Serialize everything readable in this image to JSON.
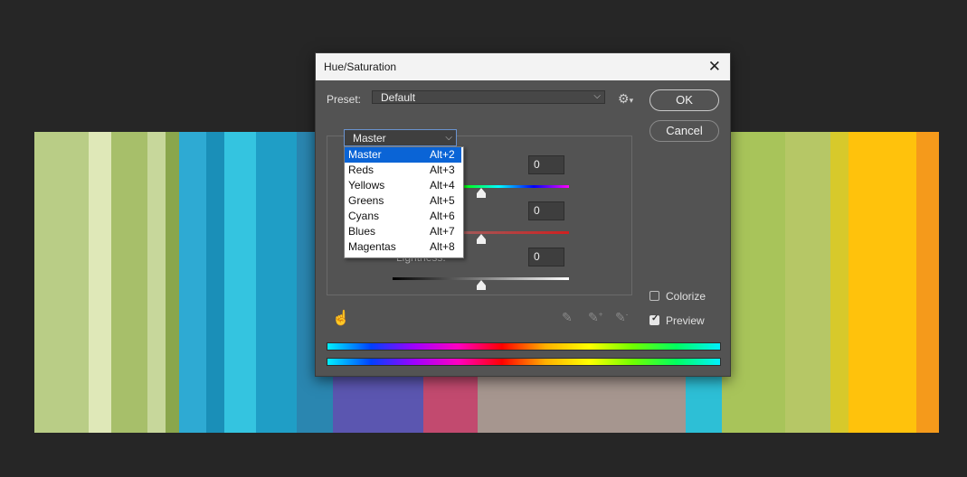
{
  "dialog": {
    "title": "Hue/Saturation",
    "close_glyph": "✕",
    "preset_label": "Preset:",
    "preset_value": "Default",
    "ok_label": "OK",
    "cancel_label": "Cancel",
    "channel_value": "Master",
    "hue_value": "0",
    "saturation_value": "0",
    "lightness_label": "Lightness:",
    "lightness_value": "0",
    "colorize_label": "Colorize",
    "colorize_checked": false,
    "preview_label": "Preview",
    "preview_checked": true,
    "hue_slider_level": 0.5,
    "saturation_slider_level": 0.5,
    "lightness_slider_level": 0.5
  },
  "channel_menu": [
    {
      "name": "Master",
      "shortcut": "Alt+2"
    },
    {
      "name": "Reds",
      "shortcut": "Alt+3"
    },
    {
      "name": "Yellows",
      "shortcut": "Alt+4"
    },
    {
      "name": "Greens",
      "shortcut": "Alt+5"
    },
    {
      "name": "Cyans",
      "shortcut": "Alt+6"
    },
    {
      "name": "Blues",
      "shortcut": "Alt+7"
    },
    {
      "name": "Magentas",
      "shortcut": "Alt+8"
    }
  ],
  "icons": {
    "preset_options": "gear-icon",
    "target_adjust": "hand-icon",
    "eyedropper": "eyedropper-icon",
    "eyedropper_add": "eyedropper-plus-icon",
    "eyedropper_subtract": "eyedropper-minus-icon"
  },
  "colors": {
    "dialog_bg": "#535353",
    "highlight": "#0a64d6",
    "app_bg": "#262626"
  }
}
